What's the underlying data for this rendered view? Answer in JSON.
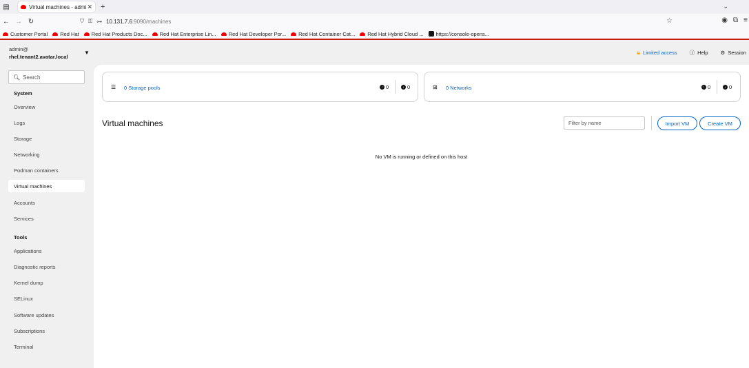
{
  "browser": {
    "tab_title": "Virtual machines - admin",
    "url_host": "10.131.7.6",
    "url_rest": ":9090/machines",
    "bookmarks": [
      "Customer Portal",
      "Red Hat",
      "Red Hat Products Doc...",
      "Red Hat Enterprise Lin...",
      "Red Hat Developer Por...",
      "Red Hat Container Cat...",
      "Red Hat Hybrid Cloud ...",
      "https://console-opens..."
    ]
  },
  "header": {
    "user": "admin@",
    "hostname": "rhel.tenant2.avatar.local",
    "limited_access": "Limited access",
    "help": "Help",
    "session": "Session"
  },
  "sidebar": {
    "search_placeholder": "Search",
    "system_title": "System",
    "system_items": [
      "Overview",
      "Logs",
      "Storage",
      "Networking",
      "Podman containers",
      "Virtual machines",
      "Accounts",
      "Services"
    ],
    "tools_title": "Tools",
    "tools_items": [
      "Applications",
      "Diagnostic reports",
      "Kernel dump",
      "SELinux",
      "Software updates",
      "Subscriptions",
      "Terminal"
    ],
    "active_item": "Virtual machines"
  },
  "main": {
    "storage_pools_link": "0 Storage pools",
    "storage_active": "0",
    "storage_inactive": "0",
    "networks_link": "0 Networks",
    "networks_active": "0",
    "networks_inactive": "0",
    "title": "Virtual machines",
    "filter_placeholder": "Filter by name",
    "import_vm": "Import VM",
    "create_vm": "Create VM",
    "empty_message": "No VM is running or defined on this host"
  },
  "colors": {
    "accent": "#0066cc",
    "brand_red": "#ee0000",
    "warning": "#f0ab00"
  }
}
